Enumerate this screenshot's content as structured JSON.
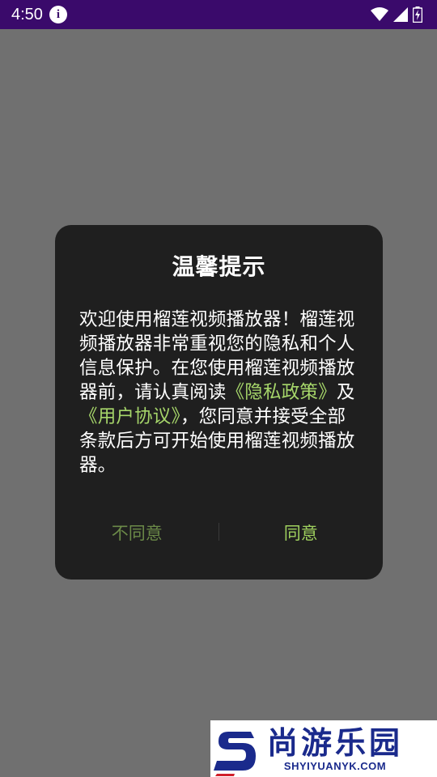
{
  "status_bar": {
    "time": "4:50"
  },
  "dialog": {
    "title": "温馨提示",
    "body_part1": "欢迎使用榴莲视频播放器！榴莲视频播放器非常重视您的隐私和个人信息保护。在您使用榴莲视频播放器前，请认真阅读",
    "privacy_link": "《隐私政策》",
    "body_and": "及",
    "user_agreement_link": "《用户协议》",
    "body_part2": "，您同意并接受全部条款后方可开始使用榴莲视频播放器。",
    "disagree_label": "不同意",
    "agree_label": "同意"
  },
  "watermark": {
    "brand_cn": "尚游乐园",
    "brand_en": "SHYIYUANYK.COM"
  },
  "colors": {
    "status_bar_bg": "#3a0a6b",
    "scrim": "#707070",
    "dialog_bg": "#1f1f1f",
    "link": "#a6d66a",
    "agree": "#9fd15e",
    "disagree": "#6b8a48",
    "watermark_blue": "#1a2a8c"
  }
}
